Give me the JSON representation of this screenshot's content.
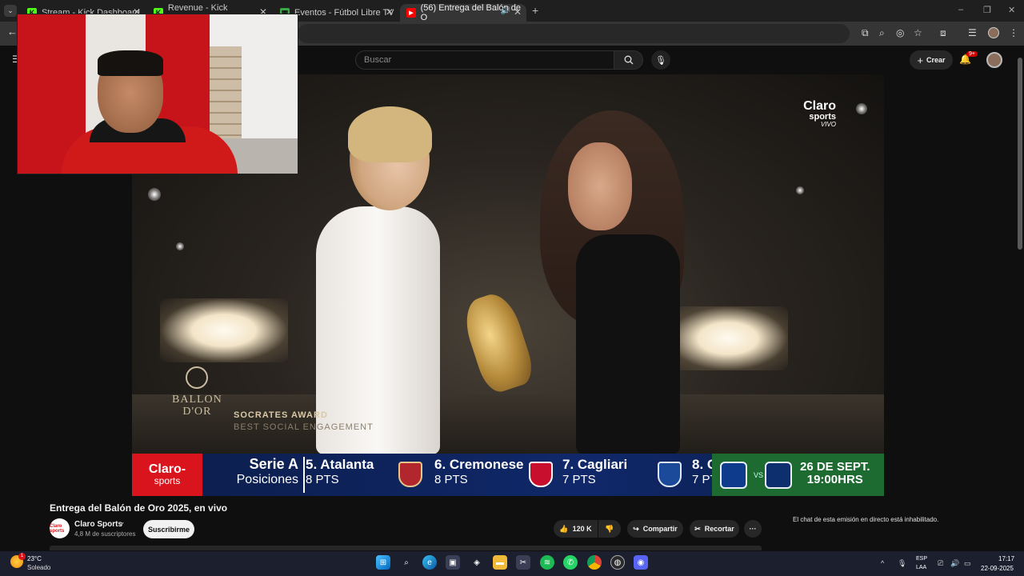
{
  "browser": {
    "tabs": [
      {
        "title": "Stream - Kick Dashboard",
        "favicon": "kick-icon",
        "color": "#53fc18"
      },
      {
        "title": "Revenue - Kick Dashboard",
        "favicon": "kick-icon",
        "color": "#53fc18"
      },
      {
        "title": "Eventos - Fútbol Libre TV",
        "favicon": "futbol-libre-icon",
        "color": "#3aa845"
      },
      {
        "title": "(56) Entrega del Balón de O",
        "favicon": "youtube-icon",
        "color": "#ff0000"
      }
    ],
    "new_tab": "+",
    "window_controls": [
      "–",
      "❐",
      "✕"
    ]
  },
  "youtube": {
    "search_placeholder": "Buscar",
    "create_label": "Crear",
    "notifications_badge": "9+"
  },
  "video": {
    "broadcaster_logo": {
      "line1": "Claro",
      "line2": "sports",
      "line3": "VIVO"
    },
    "ballon_dor": {
      "line1": "BALLON",
      "line2": "D'OR"
    },
    "award": {
      "title": "SOCRATES AWARD",
      "subtitle": "BEST SOCIAL ENGAGEMENT"
    },
    "ticker": {
      "logo": {
        "line1": "Claro-",
        "line2": "sports"
      },
      "league": "Serie A",
      "section": "Posiciones",
      "teams": [
        {
          "name": "5. Atalanta",
          "points": "8 PTS",
          "crest_color": "#b1272d"
        },
        {
          "name": "6. Cremonese",
          "points": "8 PTS",
          "crest_color": "#c8102e"
        },
        {
          "name": "7. Cagliari",
          "points": "7 PTS",
          "crest_color": "#1b4a9a"
        },
        {
          "name": "8. C",
          "points": "7 PT"
        }
      ],
      "next_match": {
        "vs": "VS",
        "date": "26 DE SEPT.",
        "time": "19:00HRS"
      }
    }
  },
  "watch": {
    "title": "Entrega del Balón de Oro 2025, en vivo",
    "channel_avatar": "Claro sports",
    "channel_name": "Claro Sports",
    "subscribers": "4,8 M de suscriptores",
    "subscribe_label": "Suscribirme",
    "likes": "120 K",
    "share_label": "Compartir",
    "clip_label": "Recortar",
    "more_label": "···",
    "chat_disabled": "El chat de esta emisión en directo está inhabilitado."
  },
  "taskbar": {
    "weather_badge": "1",
    "temperature": "23°C",
    "condition": "Soleado",
    "apps": [
      "windows-start-icon",
      "search-icon",
      "edge-icon",
      "store-icon",
      "copilot-icon",
      "file-explorer-icon",
      "snipping-tool-icon",
      "spotify-icon",
      "whatsapp-icon",
      "chrome-icon",
      "obs-icon",
      "discord-icon"
    ],
    "lang_line1": "ESP",
    "lang_line2": "LAA",
    "time": "17:17",
    "date": "22-09-2025"
  }
}
